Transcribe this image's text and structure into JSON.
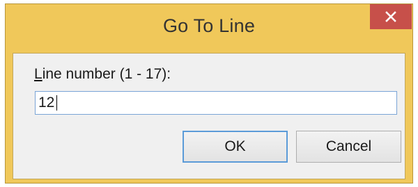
{
  "dialog": {
    "title": "Go To Line",
    "close_icon": "close-icon"
  },
  "form": {
    "label_accel": "L",
    "label_rest": "ine number (1 - 17):",
    "value": "12"
  },
  "buttons": {
    "ok_label": "OK",
    "cancel_label": "Cancel"
  },
  "colors": {
    "titlebar": "#f0c85a",
    "close_button": "#c7504a",
    "client_area": "#f0f0f0",
    "focus_border": "#5b9bd8"
  }
}
